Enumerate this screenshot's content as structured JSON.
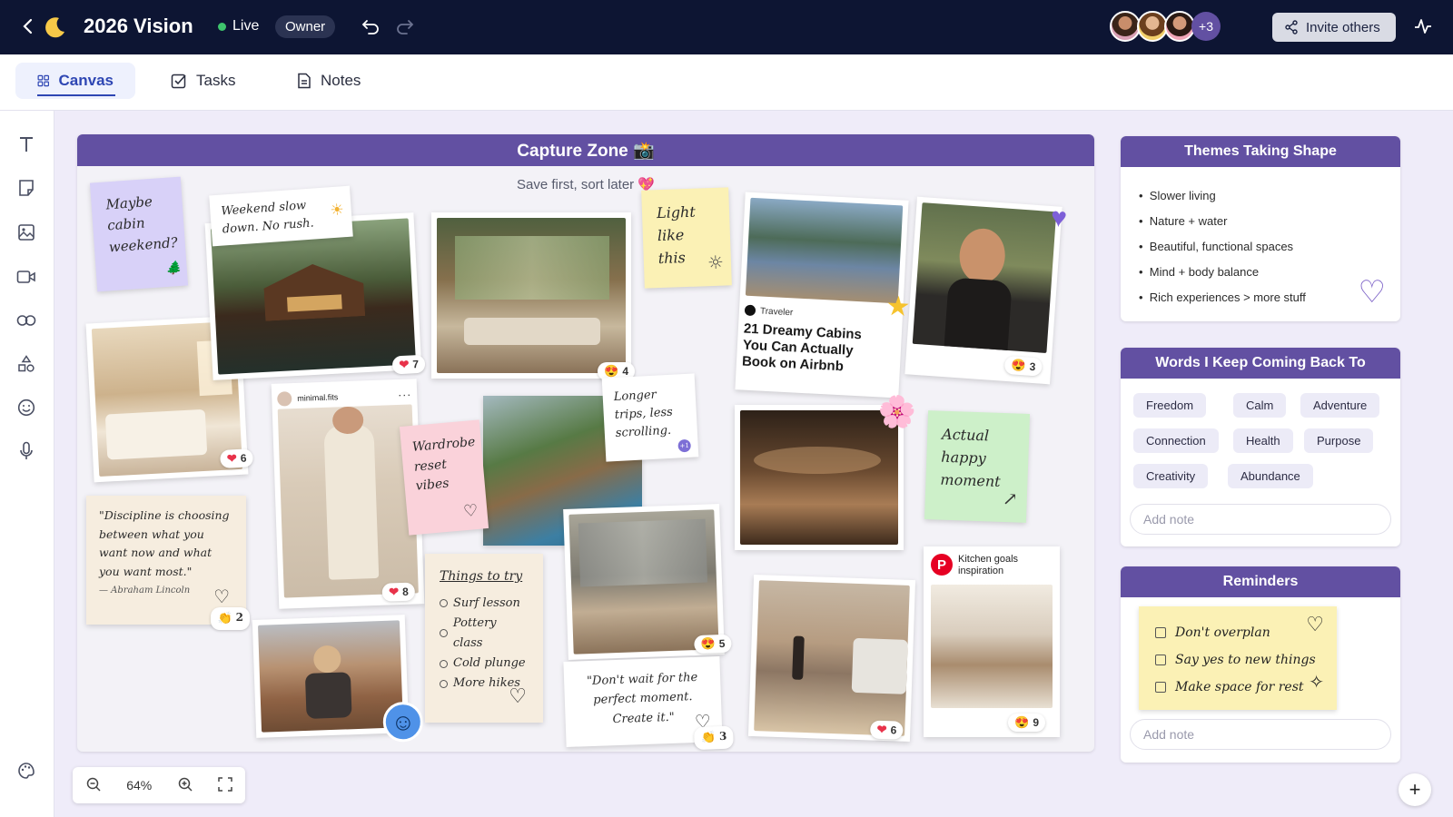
{
  "header": {
    "title": "2026 Vision",
    "live_label": "Live",
    "role_badge": "Owner",
    "collaborators_extra": "+3",
    "invite_label": "Invite others"
  },
  "tabs": [
    {
      "label": "Canvas",
      "active": true
    },
    {
      "label": "Tasks"
    },
    {
      "label": "Notes"
    }
  ],
  "toolbar_icons": [
    "text-icon",
    "sticky-note-icon",
    "image-icon",
    "video-icon",
    "link-icon",
    "shapes-icon",
    "emoji-icon",
    "microphone-icon",
    "palette-icon"
  ],
  "zoom": {
    "level": "64%"
  },
  "capture": {
    "title": "Capture Zone 📸",
    "subtitle": "Save first, sort later 💖",
    "notes": {
      "maybe_cabin": "Maybe cabin weekend?",
      "weekend_slow": "Weekend slow down. No rush.",
      "light_like_this": "Light like this",
      "longer_trips": "Longer trips, less scrolling.",
      "longer_trips_badge": "+1",
      "wardrobe": "Wardrobe reset vibes",
      "actual_happy": "Actual happy moment",
      "quote": "\"Discipline is choosing between what you want now and what you want most.\"",
      "quote_author": "— Abraham Lincoln",
      "dont_wait": "\"Don't wait for the perfect moment. Create it.\"",
      "things_title": "Things to try",
      "things_items": [
        "Surf lesson",
        "Pottery class",
        "Cold plunge",
        "More hikes"
      ]
    },
    "article": {
      "source": "Traveler",
      "title": "21 Dreamy Cabins You Can Actually Book on Airbnb"
    },
    "instagram": {
      "handle": "minimal.fits"
    },
    "pinterest": {
      "title": "Kitchen goals inspiration"
    },
    "reactions": {
      "cabin": "7",
      "living": "4",
      "woman": "3",
      "bedroom": "6",
      "outfit": "8",
      "quote": "2",
      "apartment": "5",
      "dontwait": "3",
      "beach": "6",
      "kitchen": "9"
    }
  },
  "themes": {
    "title": "Themes Taking Shape",
    "items": [
      "Slower living",
      "Nature + water",
      "Beautiful, functional spaces",
      "Mind + body balance",
      "Rich experiences > more stuff"
    ]
  },
  "words": {
    "title": "Words I Keep Coming Back To",
    "chips": [
      "Freedom",
      "Calm",
      "Adventure",
      "Connection",
      "Health",
      "Purpose",
      "Creativity",
      "Abundance"
    ],
    "add_note": "Add note"
  },
  "reminders": {
    "title": "Reminders",
    "items": [
      "Don't overplan",
      "Say yes to new things",
      "Make space for rest"
    ],
    "add_note": "Add note"
  },
  "colors": {
    "header_bg": "#0d1533",
    "accent_purple": "#6250a2",
    "canvas_bg": "#efecf9",
    "tab_active": "#2e46b3",
    "live_green": "#3ec46d",
    "sticky_yellow": "#fbf1b5",
    "sticky_purple": "#d8d1f8",
    "sticky_pink": "#fad2da",
    "sticky_green": "#cdf0c9",
    "sticky_beige": "#f6eddf"
  }
}
